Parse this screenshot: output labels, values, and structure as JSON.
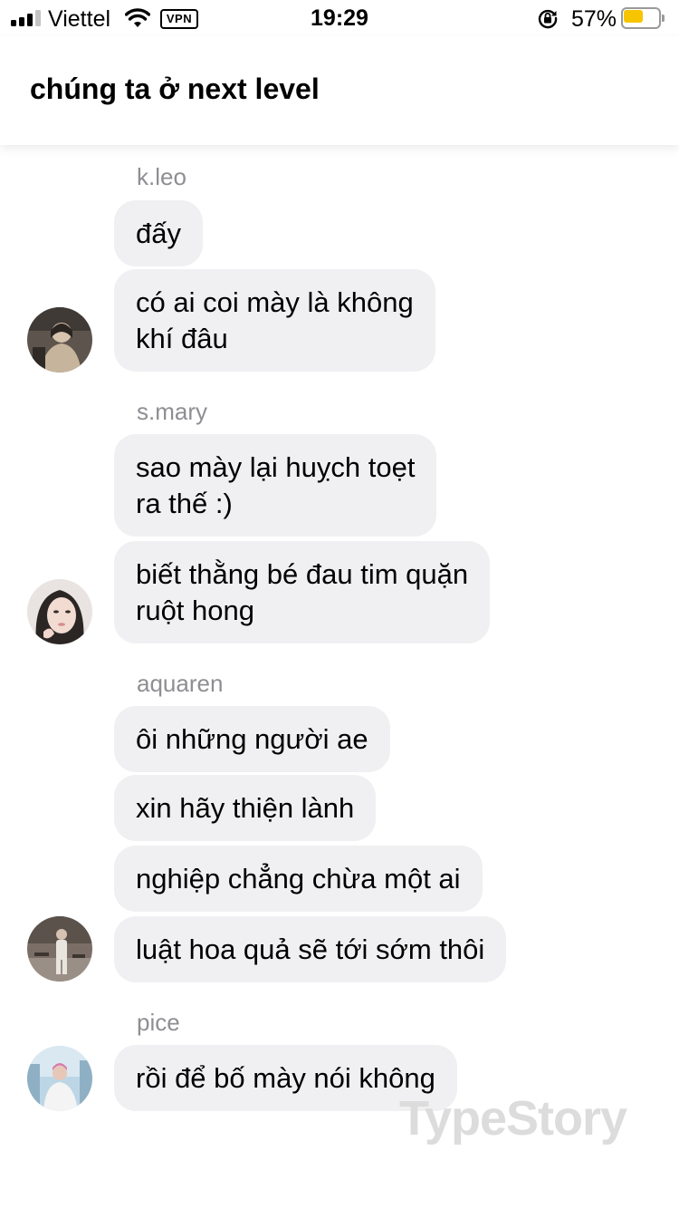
{
  "status_bar": {
    "carrier": "Viettel",
    "vpn_label": "VPN",
    "time": "19:29",
    "battery_percent_label": "57%",
    "battery_level": 0.57,
    "signal_bars_active": 3,
    "signal_bars_total": 4,
    "battery_color": "#f7c400"
  },
  "header": {
    "title": "chúng ta ở next level"
  },
  "groups": [
    {
      "sender": "k.leo",
      "messages": [
        "đấy",
        "có ai coi mày là không\nkhí đâu"
      ]
    },
    {
      "sender": "s.mary",
      "messages": [
        "sao mày lại huỵch toẹt\nra thế :)",
        "biết thằng bé đau tim quặn\nruột hong"
      ]
    },
    {
      "sender": "aquaren",
      "messages": [
        "ôi những người ae",
        "xin hãy thiện lành",
        "nghiệp chẳng chừa một ai",
        "luật hoa quả sẽ tới sớm thôi"
      ]
    },
    {
      "sender": "pice",
      "messages": [
        "rồi để bố mày nói không"
      ]
    }
  ],
  "watermark": "TypeStory",
  "colors": {
    "bubble_background": "#f0f0f2",
    "sender_name": "#8e8e93",
    "watermark": "#dcdcdc"
  }
}
